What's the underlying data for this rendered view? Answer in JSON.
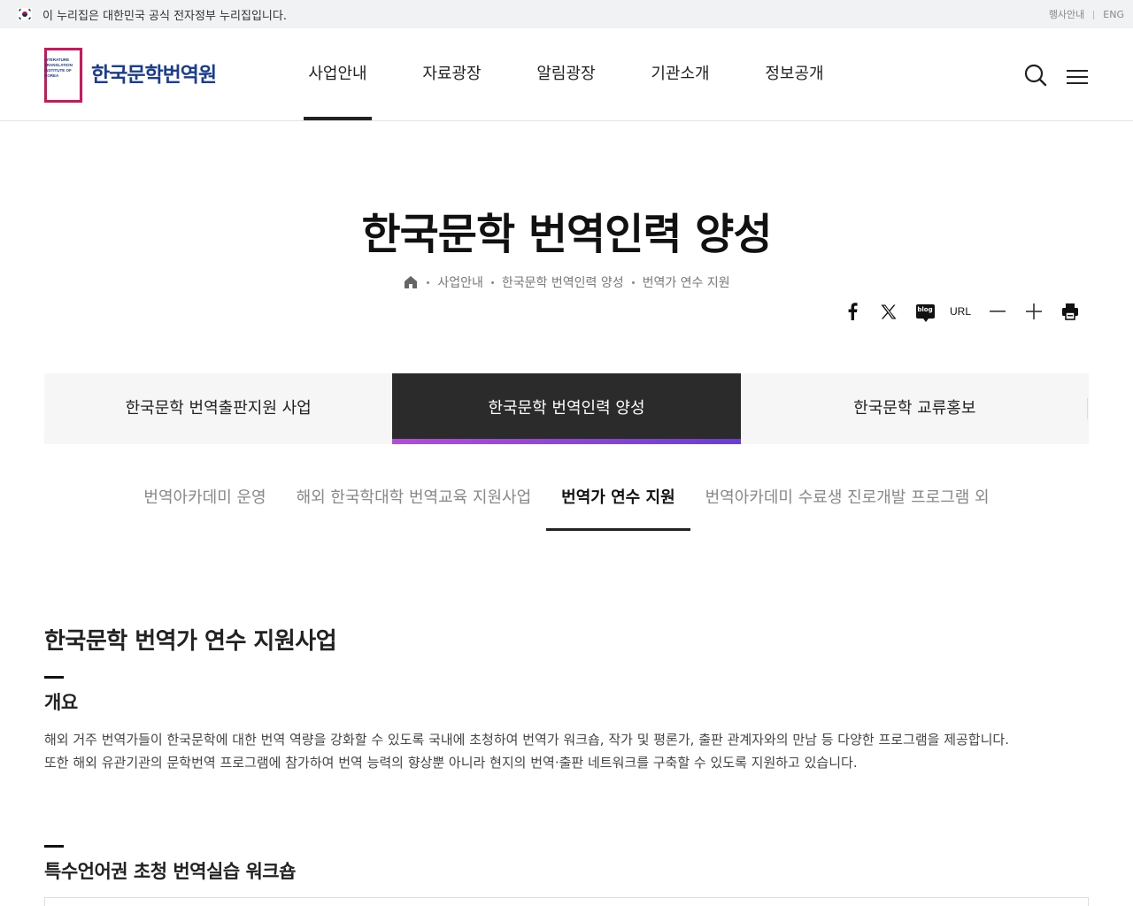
{
  "gov_banner": {
    "text": "이 누리집은 대한민국 공식 전자정부 누리집입니다.",
    "links": [
      "행사안내",
      "ENG"
    ]
  },
  "header": {
    "logo_text": "한국문학번역원",
    "logo_lines": [
      "LITERATURE",
      "TRANSLATION",
      "INSTITUTE OF",
      "KOREA"
    ],
    "nav": [
      "사업안내",
      "자료광장",
      "알림광장",
      "기관소개",
      "정보공개"
    ],
    "active_nav_index": 0,
    "search_icon": "search-icon",
    "menu_icon": "hamburger-menu-icon"
  },
  "page": {
    "title": "한국문학 번역인력 양성",
    "breadcrumb": [
      "사업안내",
      "한국문학 번역인력 양성",
      "번역가 연수 지원"
    ]
  },
  "tools": {
    "facebook_icon": "facebook-icon",
    "x_icon": "x-twitter-icon",
    "blog_label": "blog",
    "url_label": "URL",
    "zoom_out_icon": "minus-icon",
    "zoom_in_icon": "plus-icon",
    "print_icon": "print-icon"
  },
  "tabs": [
    "한국문학 번역출판지원 사업",
    "한국문학 번역인력 양성",
    "한국문학 교류홍보"
  ],
  "active_tab_index": 1,
  "subtabs": [
    "번역아카데미 운영",
    "해외 한국학대학 번역교육 지원사업",
    "번역가 연수 지원",
    "번역아카데미 수료생 진로개발 프로그램 외"
  ],
  "active_subtab_index": 2,
  "content": {
    "heading": "한국문학 번역가 연수 지원사업",
    "overview_title": "개요",
    "overview_lines": [
      "해외 거주 번역가들이 한국문학에 대한 번역 역량을 강화할 수 있도록 국내에 초청하여 번역가 워크숍, 작가 및 평론가, 출판 관계자와의 만남 등 다양한 프로그램을 제공합니다.",
      "또한 해외 유관기관의 문학번역 프로그램에 참가하여 번역 능력의 향상뿐 아니라 현지의 번역·출판 네트워크를 구축할 수 있도록 지원하고 있습니다."
    ],
    "section2_title": "특수언어권 초청 번역실습 워크숍"
  },
  "colors": {
    "brand_blue": "#1a3d8f",
    "brand_pink": "#d4145a",
    "tab_active_bg": "#2b2b2b",
    "tab_accent_start": "#b14ed6",
    "tab_accent_end": "#6a3fd0"
  }
}
